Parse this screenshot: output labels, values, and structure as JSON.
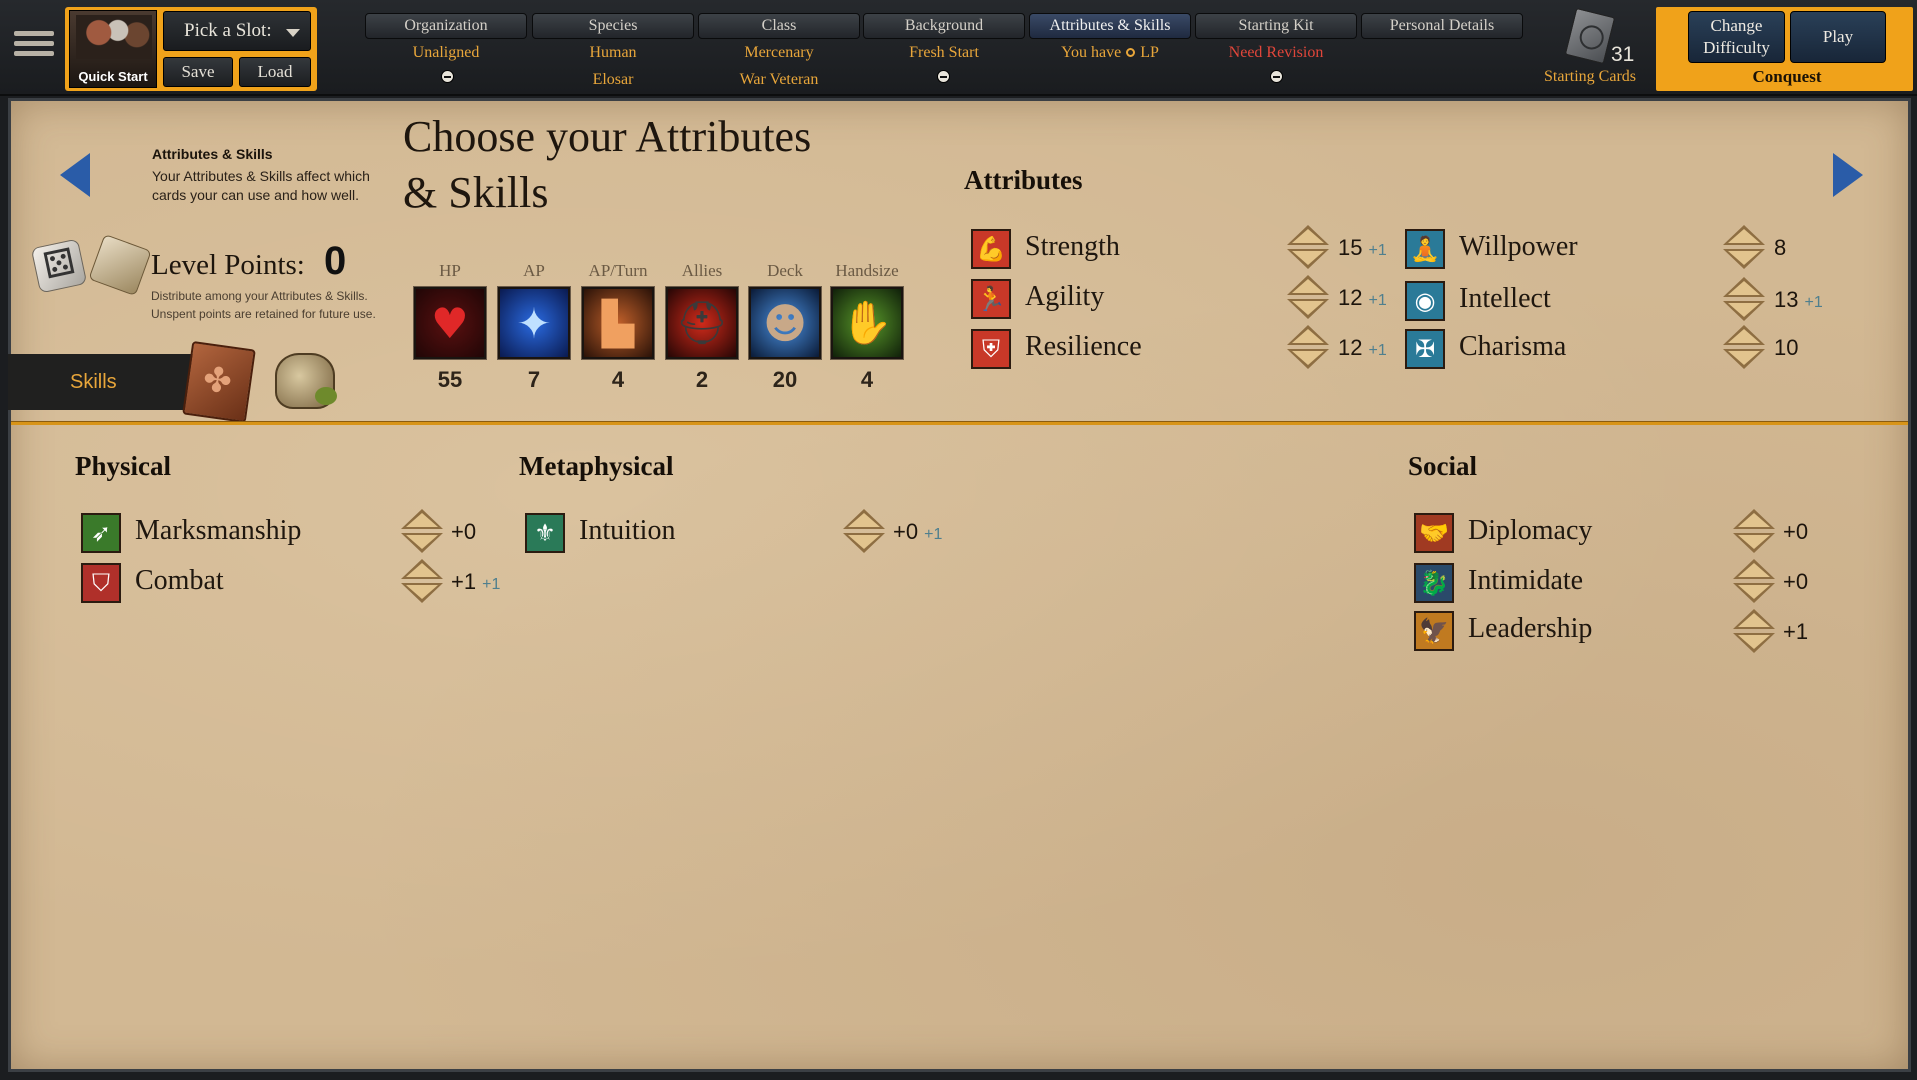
{
  "topbar": {
    "quick_start_label": "Quick Start",
    "slot_label": "Pick a Slot:",
    "save_label": "Save",
    "load_label": "Load",
    "tabs": [
      {
        "label": "Organization",
        "values": [
          "Unaligned"
        ]
      },
      {
        "label": "Species",
        "values": [
          "Human",
          "Elosar"
        ]
      },
      {
        "label": "Class",
        "values": [
          "Mercenary",
          "War Veteran"
        ]
      },
      {
        "label": "Background",
        "values": [
          "Fresh Start"
        ]
      },
      {
        "label": "Attributes & Skills",
        "value_prefix": "You have",
        "value_suffix": "LP"
      },
      {
        "label": "Starting Kit",
        "values": [
          "Need Revision"
        ]
      },
      {
        "label": "Personal Details",
        "values": []
      }
    ],
    "starting_cards_count": "31",
    "starting_cards_label": "Starting Cards",
    "change_difficulty_label": "Change Difficulty",
    "play_label": "Play",
    "difficulty": "Conquest",
    "colors": {
      "accent": "#f0a21a",
      "value_text": "#e8a63a",
      "warning": "#e0463a",
      "active_tab": "#2a3a56"
    }
  },
  "info": {
    "title": "Attributes & Skills",
    "description": "Your Attributes & Skills affect which cards your can use and how well."
  },
  "page_title": "Choose your Attributes & Skills",
  "level_points": {
    "label": "Level Points:",
    "value": "0",
    "description": "Distribute among your Attributes & Skills. Unspent points are retained for future use."
  },
  "stats": [
    {
      "label": "HP",
      "value": "55",
      "icon": "heart-icon"
    },
    {
      "label": "AP",
      "value": "7",
      "icon": "blue-flame-icon"
    },
    {
      "label": "AP/Turn",
      "value": "4",
      "icon": "boot-icon"
    },
    {
      "label": "Allies",
      "value": "2",
      "icon": "helmet-icon"
    },
    {
      "label": "Deck",
      "value": "20",
      "icon": "face-icon"
    },
    {
      "label": "Handsize",
      "value": "4",
      "icon": "hand-icon"
    }
  ],
  "skills_tab_label": "Skills",
  "attributes": {
    "heading": "Attributes",
    "items": [
      {
        "name": "Strength",
        "value": "15",
        "bonus": "+1",
        "icon": "flexed-arm-icon"
      },
      {
        "name": "Agility",
        "value": "12",
        "bonus": "+1",
        "icon": "running-figure-icon"
      },
      {
        "name": "Resilience",
        "value": "12",
        "bonus": "+1",
        "icon": "armored-torso-icon"
      },
      {
        "name": "Willpower",
        "value": "8",
        "bonus": "",
        "icon": "meditating-figure-icon"
      },
      {
        "name": "Intellect",
        "value": "13",
        "bonus": "+1",
        "icon": "brain-icon"
      },
      {
        "name": "Charisma",
        "value": "10",
        "bonus": "",
        "icon": "winged-figure-icon"
      }
    ]
  },
  "skills": {
    "physical": {
      "heading": "Physical",
      "items": [
        {
          "name": "Marksmanship",
          "value": "+0",
          "bonus": "",
          "icon": "arrows-icon"
        },
        {
          "name": "Combat",
          "value": "+1",
          "bonus": "+1",
          "icon": "spartan-helmet-icon"
        }
      ]
    },
    "metaphysical": {
      "heading": "Metaphysical",
      "items": [
        {
          "name": "Intuition",
          "value": "+0",
          "bonus": "+1",
          "icon": "eye-tree-icon"
        }
      ]
    },
    "social": {
      "heading": "Social",
      "items": [
        {
          "name": "Diplomacy",
          "value": "+0",
          "bonus": "",
          "icon": "handshake-icon"
        },
        {
          "name": "Intimidate",
          "value": "+0",
          "bonus": "",
          "icon": "dragon-head-icon"
        },
        {
          "name": "Leadership",
          "value": "+1",
          "bonus": "",
          "icon": "eagle-crest-icon"
        }
      ]
    }
  }
}
